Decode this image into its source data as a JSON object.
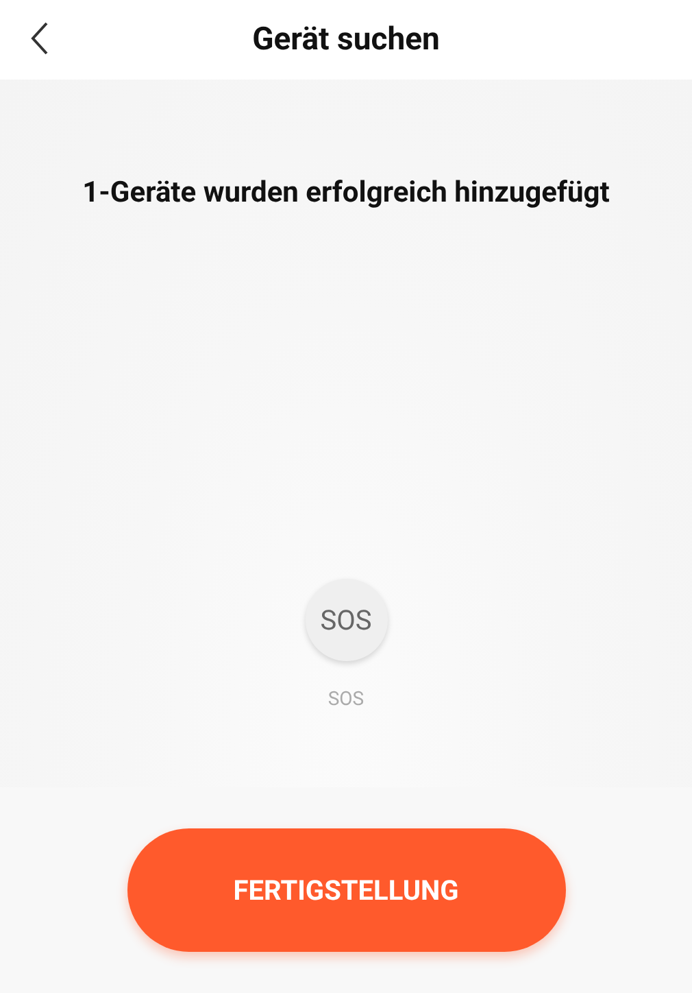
{
  "header": {
    "title": "Gerät suchen"
  },
  "message": "1-Geräte wurden erfolgreich hinzugefügt",
  "devices": [
    {
      "icon_text": "SOS",
      "name": "SOS"
    }
  ],
  "button": {
    "label": "FERTIGSTELLUNG"
  }
}
